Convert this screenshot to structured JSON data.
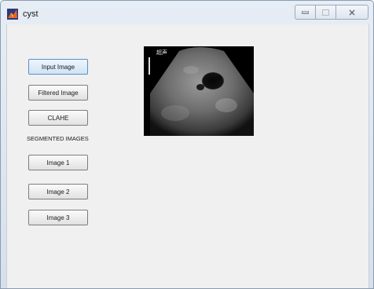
{
  "window": {
    "title": "cyst",
    "controls": [
      {
        "name": "minimize",
        "icon": "minimize-icon"
      },
      {
        "name": "maximize",
        "icon": "maximize-icon"
      },
      {
        "name": "close",
        "icon": "close-icon"
      }
    ]
  },
  "buttons": {
    "input_image": "Input Image",
    "filtered_image": "Filtered Image",
    "clahe": "CLAHE",
    "image1": "Image 1",
    "image2": "Image 2",
    "image3": "Image 3"
  },
  "segmented_label": "SEGMENTED IMAGES",
  "image_overlay_text": "超声",
  "colors": {
    "title_bar": "#dde6f0",
    "panel_bg": "#f0f0f0",
    "active_button_border": "#5a8fc5"
  }
}
